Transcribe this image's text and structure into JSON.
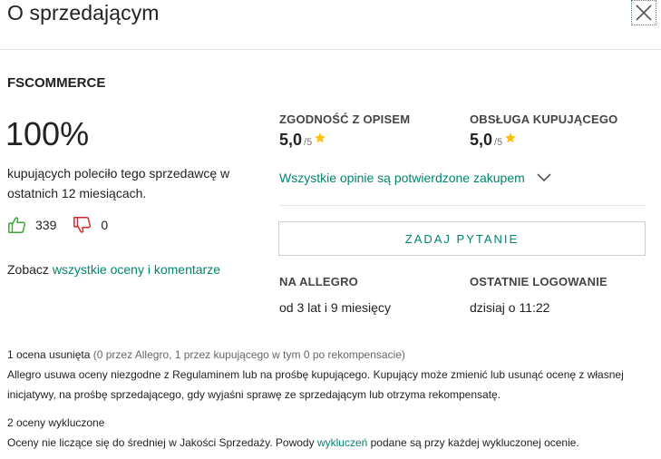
{
  "header": {
    "title": "O sprzedającym",
    "close_icon": "close-icon"
  },
  "seller": {
    "name": "FSCOMMERCE",
    "percent": "100%",
    "recommend_text": "kupujących poleciło tego sprzedawcę w ostatnich 12 miesiącach.",
    "positive_count": "339",
    "negative_count": "0",
    "see_all_prefix": "Zobacz ",
    "see_all_link": "wszystkie oceny i komentarze"
  },
  "ratings": {
    "description": {
      "label": "ZGODNOŚĆ Z OPISEM",
      "value": "5,0",
      "max": "/5"
    },
    "service": {
      "label": "OBSŁUGA KUPUJĄCEGO",
      "value": "5,0",
      "max": "/5"
    },
    "verified_text": "Wszystkie opinie są potwierdzone zakupem"
  },
  "ask_button": "ZADAJ PYTANIE",
  "info": {
    "on_allegro_label": "NA ALLEGRO",
    "on_allegro_value": "od 3 lat i 9 miesięcy",
    "last_login_label": "OSTATNIE LOGOWANIE",
    "last_login_value": "dzisiaj o 11:22"
  },
  "notes": {
    "removed_title": "1 ocena usunięta",
    "removed_detail": " (0 przez Allegro, 1 przez kupującego w tym 0 po rekompensacie)",
    "removed_desc": "Allegro usuwa oceny niezgodne z Regulaminem lub na prośbę kupującego. Kupujący może zmienić lub usunąć ocenę z własnej inicjatywy, na prośbę sprzedającego, gdy wyjaśni sprawę ze sprzedającym lub otrzyma rekompensatę.",
    "excluded_title": "2 oceny wykluczone",
    "excluded_desc_prefix": "Oceny nie liczące się do średniej w Jakości Sprzedaży. Powody ",
    "excluded_link": "wykluczeń",
    "excluded_desc_suffix": " podane są przy każdej wykluczonej ocenie."
  },
  "colors": {
    "accent": "#00856f",
    "positive": "#3aa935",
    "negative": "#d9262c",
    "star": "#ffc107"
  }
}
